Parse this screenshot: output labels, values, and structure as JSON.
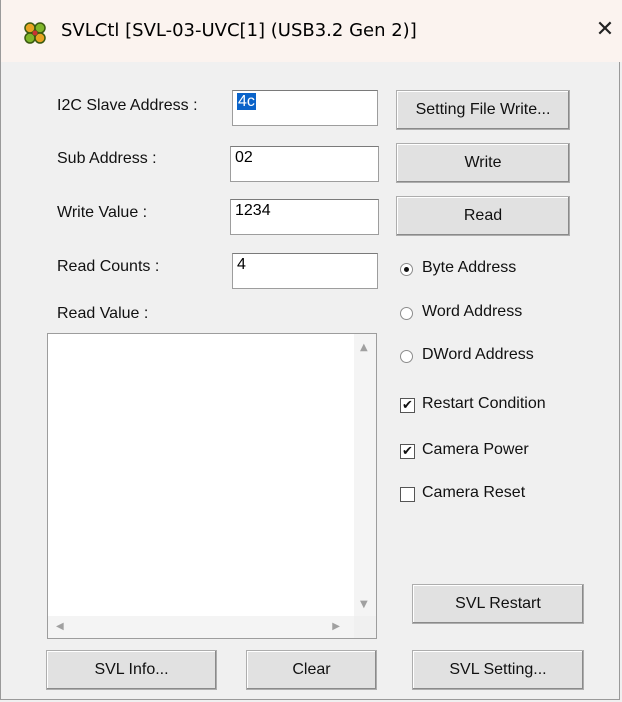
{
  "window": {
    "title": "SVLCtl [SVL-03-UVC[1] (USB3.2 Gen 2)]",
    "close_glyph": "✕",
    "app_icon": "svlctl-app-icon"
  },
  "labels": {
    "i2c_slave_address": "I2C Slave Address :",
    "sub_address": "Sub Address :",
    "write_value": "Write Value :",
    "read_counts": "Read Counts :",
    "read_value": "Read Value :"
  },
  "fields": {
    "i2c_slave_address": "4c",
    "sub_address": "02",
    "write_value": "1234",
    "read_counts": "4"
  },
  "buttons": {
    "setting_file_write": "Setting File Write...",
    "write": "Write",
    "read": "Read",
    "svl_restart": "SVL Restart",
    "svl_info": "SVL Info...",
    "clear": "Clear",
    "svl_setting": "SVL Setting..."
  },
  "address_mode": {
    "options": [
      "Byte Address",
      "Word Address",
      "DWord Address"
    ],
    "selected": "Byte Address"
  },
  "options": {
    "restart_condition": {
      "label": "Restart Condition",
      "checked": true
    },
    "camera_power": {
      "label": "Camera Power",
      "checked": true
    },
    "camera_reset": {
      "label": "Camera Reset",
      "checked": false
    }
  },
  "read_value_list": {
    "items": []
  }
}
